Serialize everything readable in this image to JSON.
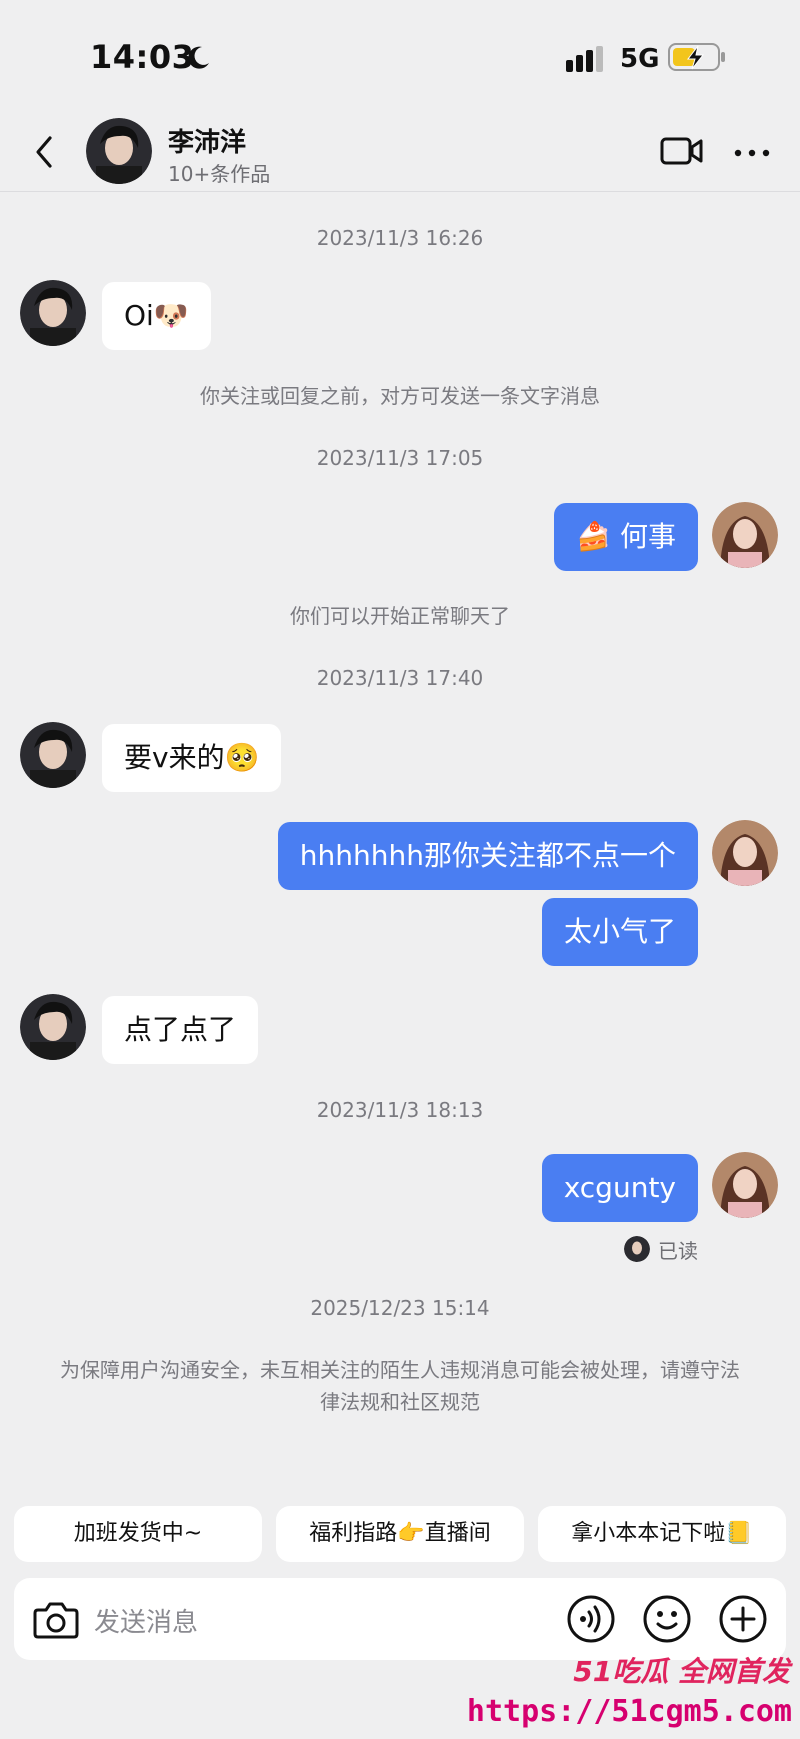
{
  "status_bar": {
    "time": "14:03",
    "network": "5G",
    "icons": [
      "moon-icon",
      "signal-icon",
      "battery-charging-icon"
    ]
  },
  "header": {
    "contact_name": "李沛洋",
    "contact_subtitle": "10+条作品",
    "icons": [
      "back-icon",
      "video-call-icon",
      "more-icon"
    ]
  },
  "messages": {
    "ts1": "2023/11/3 16:26",
    "m1": "Oi🐶",
    "note1": "你关注或回复之前，对方可发送一条文字消息",
    "ts2": "2023/11/3 17:05",
    "m2": "何事",
    "note2": "你们可以开始正常聊天了",
    "ts3": "2023/11/3 17:40",
    "m3": "要v来的🥺",
    "m4": "hhhhhhh那你关注都不点一个",
    "m5": "太小气了",
    "m6": "点了点了",
    "ts4": "2023/11/3 18:13",
    "m7": "xcgunty",
    "read_label": "已读",
    "ts5": "2025/12/23 15:14",
    "note3": "为保障用户沟通安全，未互相关注的陌生人违规消息可能会被处理，请遵守法律法规和社区规范"
  },
  "quick_replies": {
    "r1": "加班发货中~",
    "r2": "福利指路👉直播间",
    "r3": "拿小本本记下啦📒"
  },
  "input": {
    "placeholder": "发送消息",
    "icons": [
      "camera-icon",
      "voice-icon",
      "emoji-icon",
      "plus-icon"
    ]
  },
  "watermark": {
    "brand": "51吃瓜 全网首发",
    "url": "https://51cgm5.com"
  },
  "colors": {
    "background": "#efeff0",
    "outgoing_bubble": "#4a7ef2",
    "incoming_bubble": "#ffffff",
    "watermark": "#d6006f"
  }
}
